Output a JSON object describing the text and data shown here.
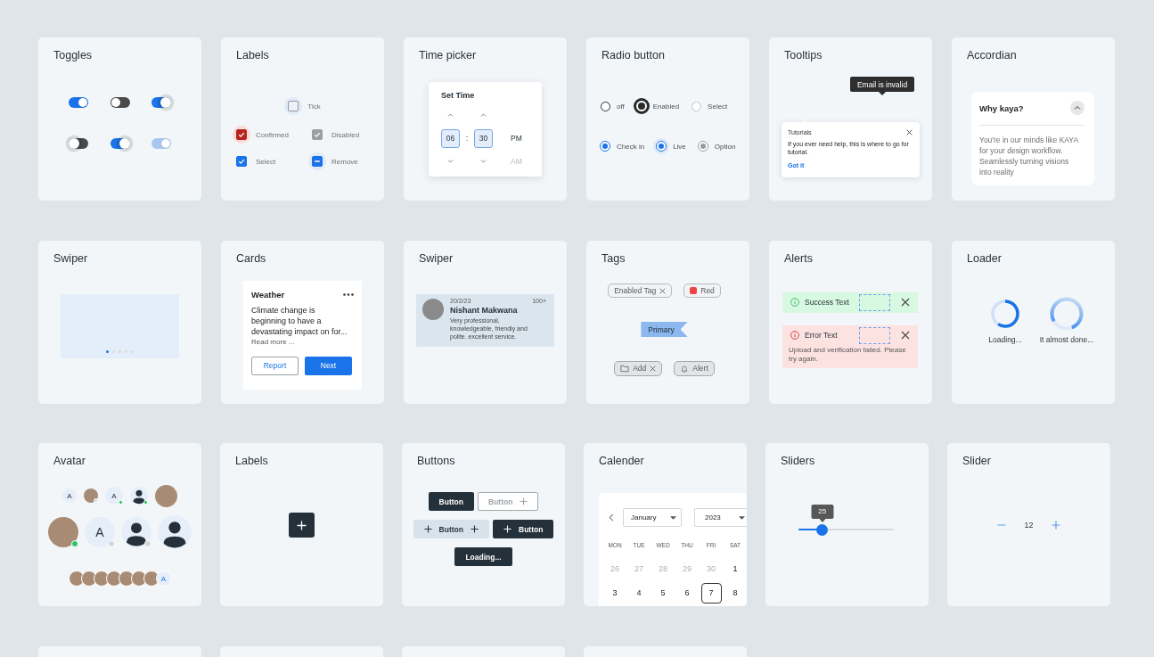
{
  "rows": [
    [
      {
        "kind": "toggles",
        "title": "Toggles",
        "toggles": [
          {
            "on": true,
            "focused": false,
            "disabled": false
          },
          {
            "on": false,
            "focused": false,
            "disabled": false
          },
          {
            "on": true,
            "focused": true,
            "disabled": false
          },
          {
            "on": false,
            "focused": true,
            "disabled": false
          },
          {
            "on": true,
            "focused": true,
            "disabled": false
          },
          {
            "on": true,
            "focused": false,
            "disabled": true
          }
        ]
      },
      {
        "kind": "checkboxes",
        "title": "Labels",
        "items": [
          {
            "kind": "plain",
            "label": "Tick",
            "checked": false,
            "focused": true
          },
          {
            "kind": "error",
            "label": "Confirmed",
            "checked": true,
            "focused": true
          },
          {
            "kind": "disabled",
            "label": "Disabled",
            "checked": true,
            "focused": false
          },
          {
            "kind": "plain",
            "label": "Select",
            "checked": true,
            "focused": false
          },
          {
            "kind": "indeterminate",
            "label": "Remove",
            "checked": true,
            "focused": true
          }
        ]
      },
      {
        "kind": "time_picker",
        "title": "Time picker",
        "panel_title": "Set Time",
        "hour": "06",
        "separator": ":",
        "minute": "30",
        "periods": [
          {
            "label": "PM",
            "selected": true
          },
          {
            "label": "AM",
            "selected": false
          }
        ]
      },
      {
        "kind": "radios",
        "title": "Radio button",
        "groups": [
          {
            "kind": "dark",
            "items": [
              {
                "label": "off",
                "selected": false,
                "focused": false,
                "disabled": false
              },
              {
                "label": "Enabled",
                "selected": true,
                "focused": true,
                "disabled": false
              },
              {
                "label": "Select",
                "selected": false,
                "focused": false,
                "disabled": true
              }
            ]
          },
          {
            "kind": "primary",
            "items": [
              {
                "label": "Check in",
                "selected": true,
                "focused": false,
                "disabled": false
              },
              {
                "label": "Live",
                "selected": true,
                "focused": true,
                "disabled": false
              },
              {
                "label": "Option",
                "selected": true,
                "focused": false,
                "disabled": true
              }
            ]
          }
        ]
      },
      {
        "kind": "tooltips",
        "title": "Tooltips",
        "tooltip": "Email is invalid",
        "popover": {
          "heading": "Tutorials",
          "body": "If you ever need help, this is where to go for tutorial.",
          "action": "Got it"
        }
      },
      {
        "kind": "accordion",
        "title": "Accordian",
        "item": {
          "heading": "Why kaya?",
          "expanded": true,
          "body": "You're in our minds like KAYA for your design workflow. Seamlessly turning visions into reality"
        }
      }
    ],
    [
      {
        "kind": "slide_swiper",
        "title": "Swiper",
        "dots": [
          {
            "selected": true
          },
          {
            "selected": false
          },
          {
            "selected": false
          },
          {
            "selected": false
          },
          {
            "selected": false
          }
        ]
      },
      {
        "kind": "info_card",
        "title": "Cards",
        "card": {
          "heading": "Weather",
          "body": "Climate change is beginning to have a devastating impact on for...",
          "link": "Read more ...",
          "buttons": [
            {
              "label": "Report",
              "kind": "outline"
            },
            {
              "label": "Next",
              "kind": "primary"
            }
          ]
        }
      },
      {
        "kind": "review_swiper",
        "title": "Swiper",
        "review": {
          "date": "20/2/23",
          "count": "100+",
          "name": "Nishant Makwana",
          "text": "Very professional, knowledgeable, friendly and polite. excellent service."
        }
      },
      {
        "kind": "tags",
        "title": "Tags",
        "tag_rows": [
          [
            {
              "kind": "outline",
              "label": "Enabled Tag",
              "removable": true
            },
            {
              "kind": "swatch",
              "label": "Red",
              "color": "#ef4444",
              "removable": false
            }
          ],
          [
            {
              "kind": "ribbon",
              "label": "Primary",
              "removable": false
            }
          ],
          [
            {
              "kind": "filled",
              "label": "Add",
              "removable": true
            },
            {
              "kind": "filled",
              "label": "Alert",
              "removable": false
            }
          ]
        ]
      },
      {
        "kind": "alerts",
        "title": "Alerts",
        "alerts": [
          {
            "kind": "success",
            "text": "Success Text"
          },
          {
            "kind": "error",
            "text": "Error Text",
            "detail": "Upload and verification failed. Please try again."
          }
        ]
      },
      {
        "kind": "loaders",
        "title": "Loader",
        "loaders": [
          {
            "kind": "solid",
            "label": "Loading..."
          },
          {
            "kind": "gradient",
            "label": "It almost done..."
          }
        ]
      }
    ],
    [
      {
        "kind": "avatars",
        "title": "Avatar",
        "rows": [
          [
            {
              "kind": "initial",
              "text": "A"
            },
            {
              "kind": "photo",
              "color": "#d4d6d8"
            },
            {
              "kind": "initial",
              "text": "A",
              "color": "#22c55e"
            },
            {
              "kind": "person",
              "color": "#22c55e"
            },
            {
              "kind": "photo"
            }
          ],
          [
            {
              "kind": "photo",
              "color": "#22c55e"
            },
            {
              "kind": "initial",
              "text": "A",
              "color": "#d4d6d8"
            },
            {
              "kind": "person",
              "color": "#d4d6d8"
            },
            {
              "kind": "person"
            }
          ]
        ],
        "group": [
          {
            "kind": "photo"
          },
          {
            "kind": "photo"
          },
          {
            "kind": "photo"
          },
          {
            "kind": "photo"
          },
          {
            "kind": "photo"
          },
          {
            "kind": "photo"
          },
          {
            "kind": "photo"
          },
          {
            "kind": "initial",
            "text": "A"
          }
        ]
      },
      {
        "kind": "icon_button",
        "title": "Labels"
      },
      {
        "kind": "buttons",
        "title": "Buttons",
        "rows": [
          [
            {
              "label": "Button",
              "kind": "dark",
              "leading_icon": false,
              "trailing_icon": false
            },
            {
              "label": "Button",
              "kind": "outline",
              "leading_icon": false,
              "trailing_icon": true
            }
          ],
          [
            {
              "label": "Button",
              "kind": "light",
              "leading_icon": true,
              "trailing_icon": true
            },
            {
              "label": "Button",
              "kind": "dark",
              "leading_icon": true,
              "trailing_icon": false
            }
          ],
          [
            {
              "label": "Loading...",
              "kind": "dark",
              "leading_icon": false,
              "trailing_icon": false
            }
          ]
        ]
      },
      {
        "kind": "calendar",
        "title": "Calender",
        "month": "January",
        "year": "2023",
        "weekdays": [
          "MON",
          "TUE",
          "WED",
          "THU",
          "FRI",
          "SAT"
        ],
        "weeks": [
          [
            {
              "day": "26",
              "outside": true,
              "selected": false
            },
            {
              "day": "27",
              "outside": true,
              "selected": false
            },
            {
              "day": "28",
              "outside": true,
              "selected": false
            },
            {
              "day": "29",
              "outside": true,
              "selected": false
            },
            {
              "day": "30",
              "outside": true,
              "selected": false
            },
            {
              "day": "1",
              "outside": false,
              "selected": false
            }
          ],
          [
            {
              "day": "3",
              "outside": false,
              "selected": false
            },
            {
              "day": "4",
              "outside": false,
              "selected": false
            },
            {
              "day": "5",
              "outside": false,
              "selected": false
            },
            {
              "day": "6",
              "outside": false,
              "selected": false
            },
            {
              "day": "7",
              "outside": false,
              "selected": true
            },
            {
              "day": "8",
              "outside": false,
              "selected": false
            }
          ]
        ]
      },
      {
        "kind": "slider",
        "title": "Sliders",
        "value": "25",
        "level": 0.25
      },
      {
        "kind": "stepper",
        "title": "Slider",
        "value": "12"
      }
    ],
    [
      {
        "kind": "blank"
      },
      {
        "kind": "blank"
      },
      {
        "kind": "blank"
      },
      {
        "kind": "blank"
      }
    ]
  ]
}
